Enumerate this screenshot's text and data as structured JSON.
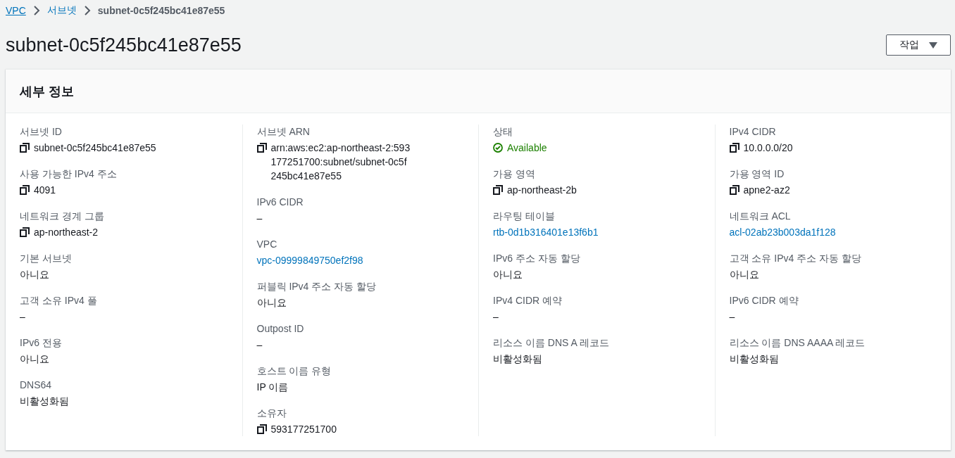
{
  "breadcrumbs": [
    {
      "label": "VPC",
      "kind": "link"
    },
    {
      "label": "서브넷",
      "kind": "link"
    },
    {
      "label": "subnet-0c5f245bc41e87e55",
      "kind": "current"
    }
  ],
  "title": "subnet-0c5f245bc41e87e55",
  "actions_button": {
    "label": "작업"
  },
  "panel": {
    "title": "세부 정보",
    "columns": [
      [
        {
          "label": "서브넷 ID",
          "value": "subnet-0c5f245bc41e87e55",
          "kind": "copy"
        },
        {
          "label": "사용 가능한 IPv4 주소",
          "value": "4091",
          "kind": "copy"
        },
        {
          "label": "네트워크 경계 그룹",
          "value": "ap-northeast-2",
          "kind": "copy"
        },
        {
          "label": "기본 서브넷",
          "value": "아니요",
          "kind": "text"
        },
        {
          "label": "고객 소유 IPv4 풀",
          "value": "–",
          "kind": "text"
        },
        {
          "label": "IPv6 전용",
          "value": "아니요",
          "kind": "text"
        },
        {
          "label": "DNS64",
          "value": "비활성화됨",
          "kind": "text"
        }
      ],
      [
        {
          "label": "서브넷 ARN",
          "value": "arn:aws:ec2:ap-northeast-2:593177251700:subnet/subnet-0c5f245bc41e87e55",
          "kind": "copy"
        },
        {
          "label": "IPv6 CIDR",
          "value": "–",
          "kind": "text"
        },
        {
          "label": "VPC",
          "value": "vpc-09999849750ef2f98",
          "kind": "link"
        },
        {
          "label": "퍼블릭 IPv4 주소 자동 할당",
          "value": "아니요",
          "kind": "text"
        },
        {
          "label": "Outpost ID",
          "value": "–",
          "kind": "text"
        },
        {
          "label": "호스트 이름 유형",
          "value": "IP 이름",
          "kind": "text"
        },
        {
          "label": "소유자",
          "value": "593177251700",
          "kind": "copy"
        }
      ],
      [
        {
          "label": "상태",
          "value": "Available",
          "kind": "status"
        },
        {
          "label": "가용 영역",
          "value": "ap-northeast-2b",
          "kind": "copy"
        },
        {
          "label": "라우팅 테이블",
          "value": "rtb-0d1b316401e13f6b1",
          "kind": "link"
        },
        {
          "label": "IPv6 주소 자동 할당",
          "value": "아니요",
          "kind": "text"
        },
        {
          "label": "IPv4 CIDR 예약",
          "value": "–",
          "kind": "text"
        },
        {
          "label": "리소스 이름 DNS A 레코드",
          "value": "비활성화됨",
          "kind": "text"
        }
      ],
      [
        {
          "label": "IPv4 CIDR",
          "value": "10.0.0.0/20",
          "kind": "copy"
        },
        {
          "label": "가용 영역 ID",
          "value": "apne2-az2",
          "kind": "copy"
        },
        {
          "label": "네트워크 ACL",
          "value": "acl-02ab23b003da1f128",
          "kind": "link"
        },
        {
          "label": "고객 소유 IPv4 주소 자동 할당",
          "value": "아니요",
          "kind": "text"
        },
        {
          "label": "IPv6 CIDR 예약",
          "value": "–",
          "kind": "text"
        },
        {
          "label": "리소스 이름 DNS AAAA 레코드",
          "value": "비활성화됨",
          "kind": "text"
        }
      ]
    ]
  }
}
